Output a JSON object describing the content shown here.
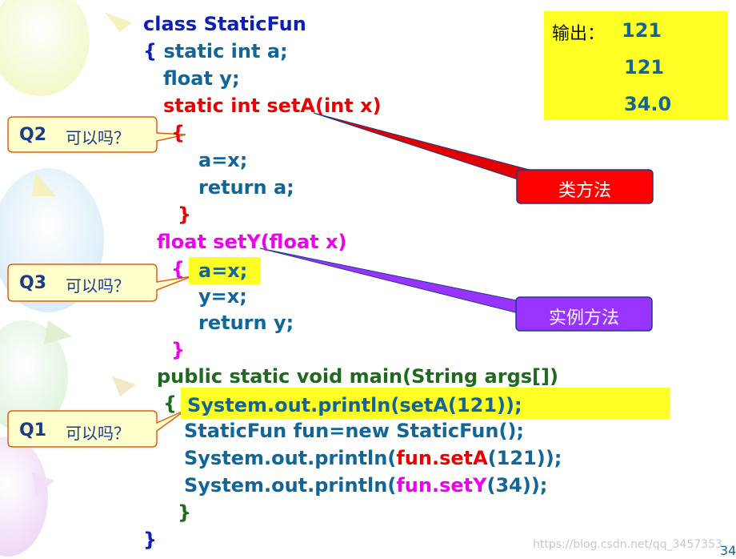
{
  "code": {
    "l1": "class StaticFun",
    "l2": "{ static int a;",
    "l3": "float y;",
    "l4": "static int setA(int x)",
    "l5": "{",
    "l6": "a=x;",
    "l7": "return a;",
    "l8": "}",
    "l9": "float setY(float x)",
    "l10_brace": "{",
    "l10": "a=x;",
    "l11": "y=x;",
    "l12": "return y;",
    "l13": "}",
    "l14": "public static void main(String args[])",
    "l15_brace": "{",
    "l15": "System.out.println(setA(121));",
    "l16": "StaticFun fun=new StaticFun();",
    "l17_a": "System.out.println(",
    "l17_b": "fun.setA",
    "l17_c": "(121));",
    "l18_a": "System.out.println(",
    "l18_b": "fun.setY",
    "l18_c": "(34));",
    "l19": "}",
    "l20": "}"
  },
  "output": {
    "label": "输出：",
    "values": [
      "121",
      "121",
      "34.0"
    ]
  },
  "callouts": [
    {
      "id": "Q2",
      "text": "可以吗？"
    },
    {
      "id": "Q3",
      "text": "可以吗？"
    },
    {
      "id": "Q1",
      "text": "可以吗？"
    }
  ],
  "tags": {
    "class_method": "类方法",
    "instance_method": "实例方法"
  },
  "colors": {
    "highlight": "#ffff26",
    "class_method_box": "#ff0000",
    "instance_method_box": "#9933ff",
    "callout_fill": "#ffffcc",
    "callout_border": "#e06010"
  },
  "watermark": "https://blog.csdn.net/qq_3457353",
  "page_number": "34"
}
